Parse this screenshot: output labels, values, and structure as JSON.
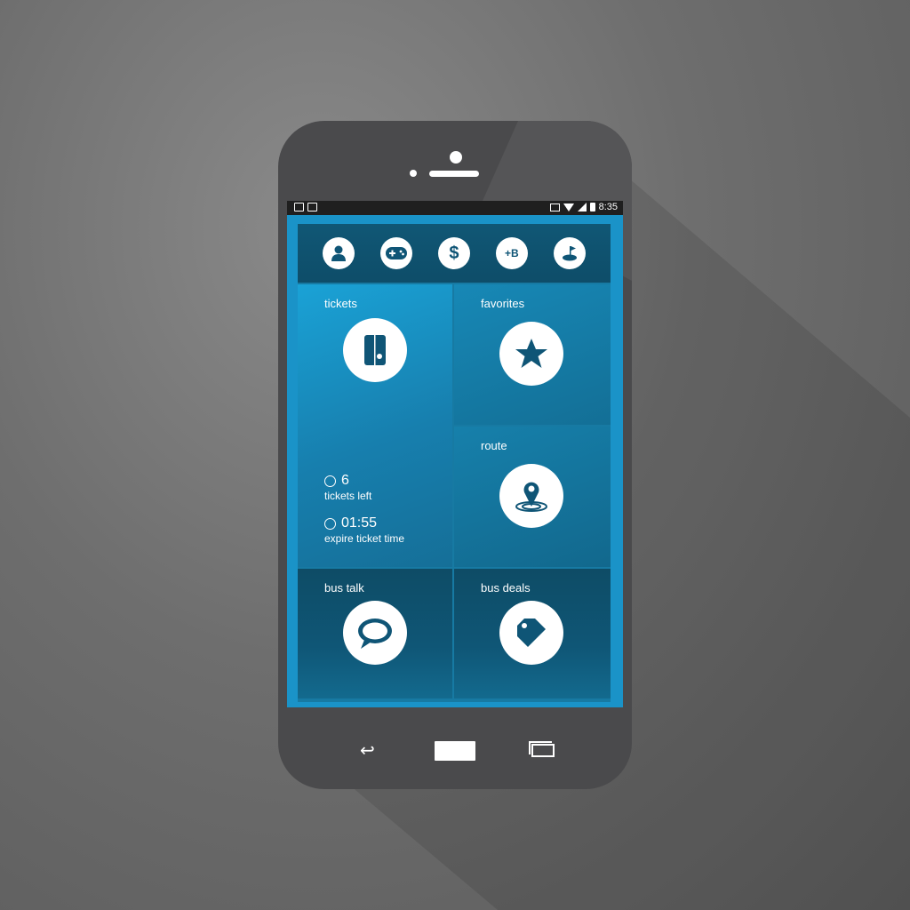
{
  "statusbar": {
    "time": "8:35"
  },
  "topbar": {
    "icons": [
      "user-icon",
      "gamepad-icon",
      "dollar-icon",
      "plus-b-icon",
      "golf-icon"
    ],
    "dollar_glyph": "$",
    "plus_b_glyph": "+B"
  },
  "tiles": {
    "tickets": {
      "label": "tickets",
      "tickets_left_value": "6",
      "tickets_left_label": "tickets left",
      "expire_value": "01:55",
      "expire_label": "expire ticket time"
    },
    "favorites": {
      "label": "favorites"
    },
    "route": {
      "label": "route"
    },
    "bus_talk": {
      "label": "bus talk"
    },
    "bus_deals": {
      "label": "bus deals"
    }
  },
  "navbar": {
    "back_glyph": "↩"
  },
  "colors": {
    "background": "#6e6e6e",
    "phone_body": "#4a4a4c",
    "screen_accent": "#1a93c8",
    "tile_dark": "#0f5676",
    "icon_fill": "#0f5576"
  }
}
